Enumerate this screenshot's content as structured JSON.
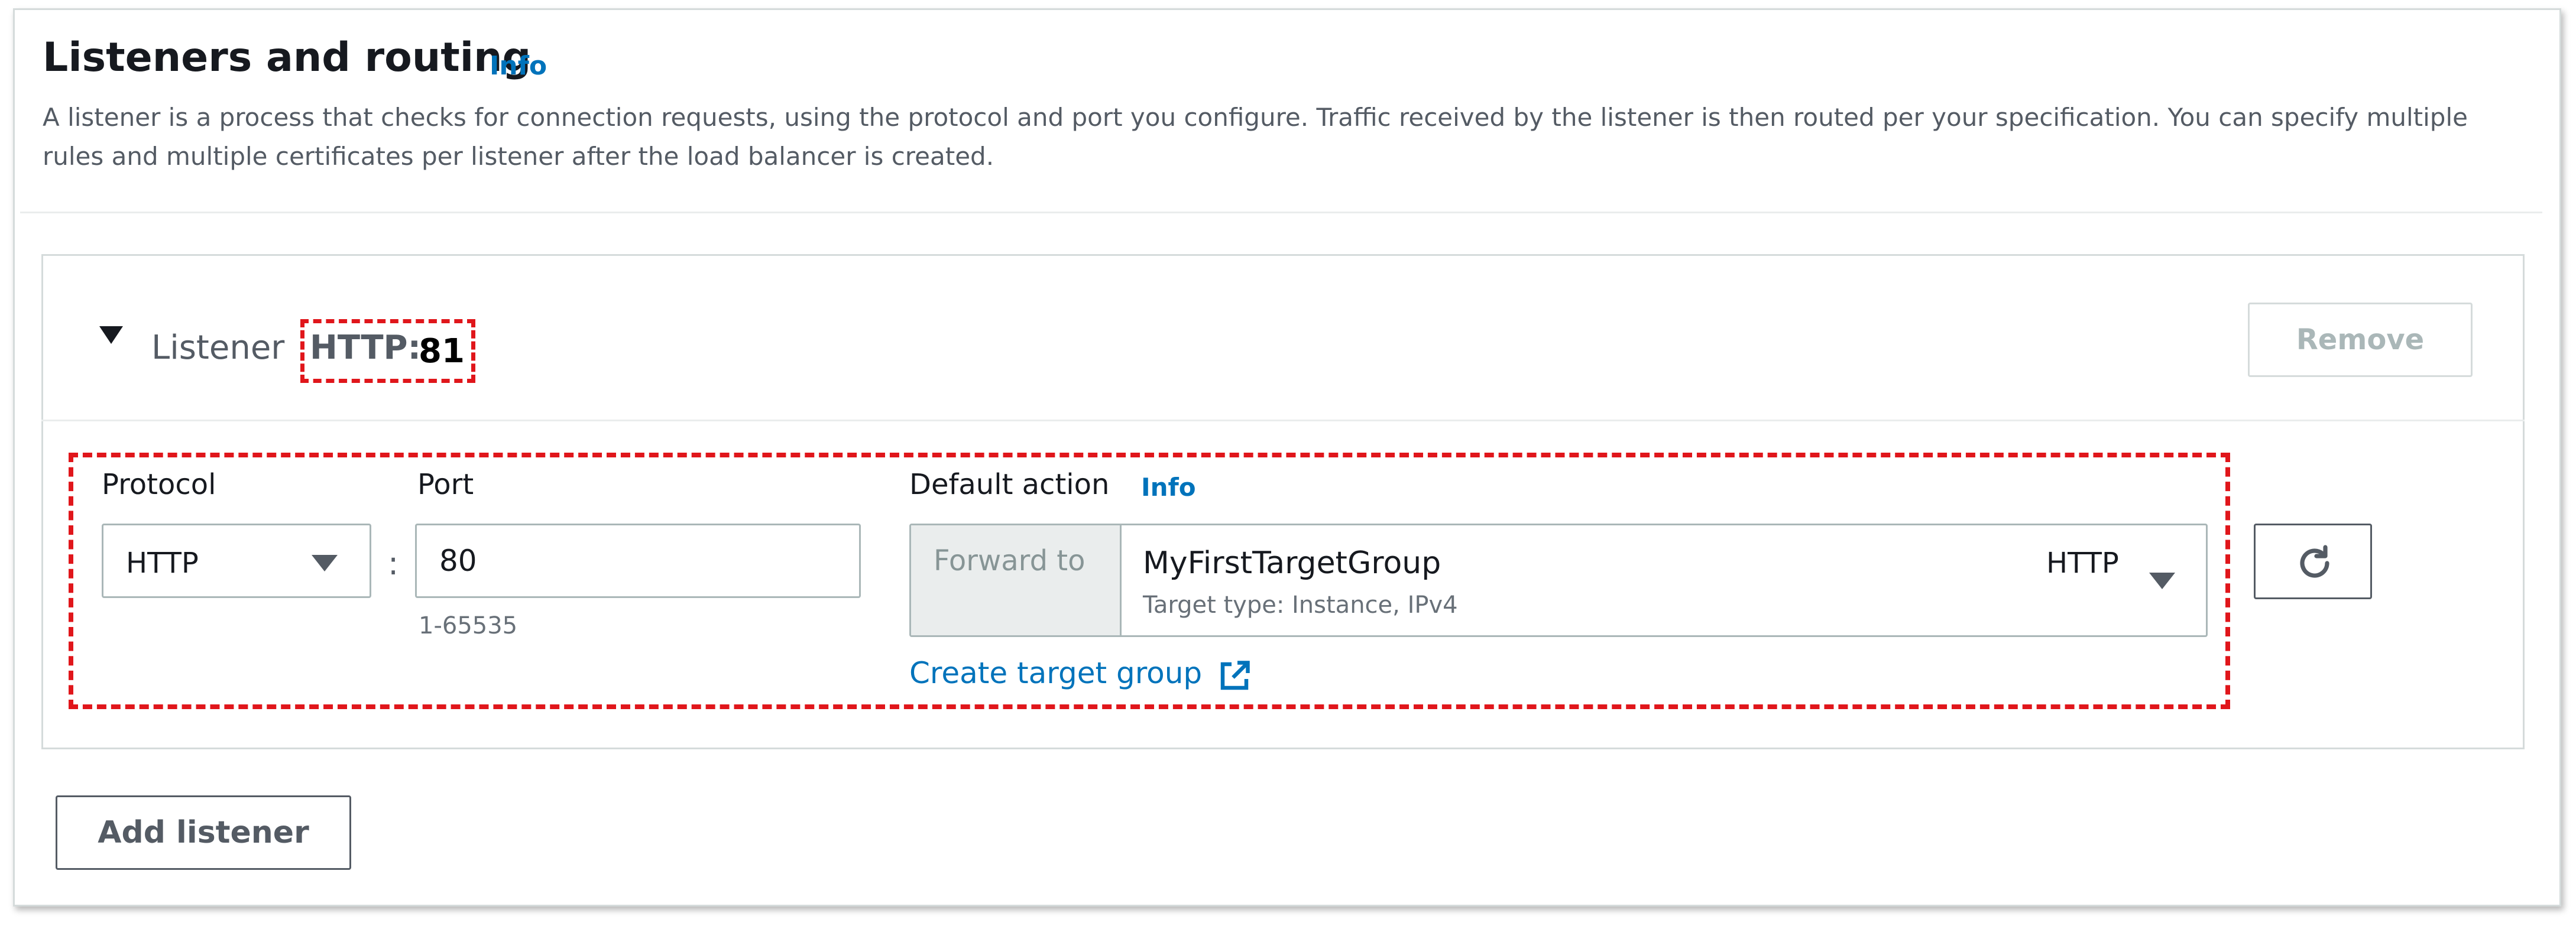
{
  "section": {
    "title": "Listeners and routing",
    "info": "Info",
    "description": "A listener is a process that checks for connection requests, using the protocol and port you configure. Traffic received by the listener is then routed per your specification. You can specify multiple rules and multiple certificates per listener after the load balancer is created."
  },
  "listener": {
    "label": "Listener",
    "badge_protocol": "HTTP:",
    "badge_port": "81",
    "remove_label": "Remove",
    "protocol": {
      "label": "Protocol",
      "value": "HTTP"
    },
    "separator": ":",
    "port": {
      "label": "Port",
      "value": "80",
      "hint": "1-65535"
    },
    "default_action": {
      "label": "Default action",
      "info": "Info",
      "forward_label": "Forward to",
      "target_group_name": "MyFirstTargetGroup",
      "target_group_detail": "Target type: Instance, IPv4",
      "target_group_protocol": "HTTP",
      "create_link": "Create target group"
    }
  },
  "footer": {
    "add_listener_label": "Add listener"
  },
  "icons": {
    "expand": "caret-down-icon",
    "dropdown": "chevron-down-icon",
    "external": "external-link-icon",
    "refresh": "refresh-icon"
  },
  "colors": {
    "link": "#0073bb",
    "highlight": "#e0161b",
    "border": "#aab7b8"
  }
}
